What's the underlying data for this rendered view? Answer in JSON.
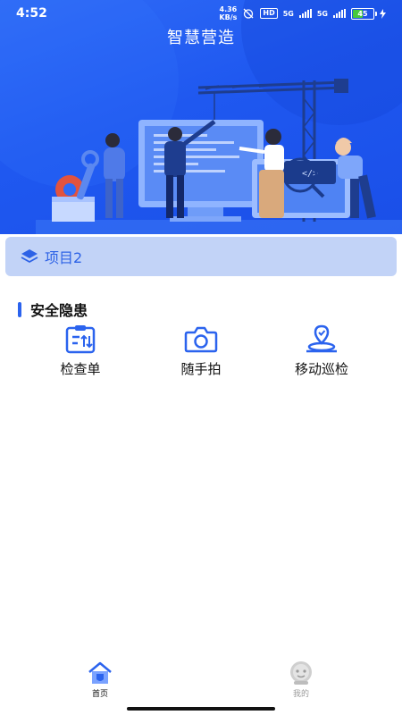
{
  "status_bar": {
    "time": "4:52",
    "net_speed_value": "4.36",
    "net_speed_unit": "KB/s",
    "hd_badge": "HD",
    "sim1_label": "5G",
    "sim2_label": "5G",
    "battery_level": "45",
    "battery_fraction": 0.45
  },
  "header": {
    "title": "智慧营造"
  },
  "project": {
    "label": "项目2"
  },
  "section": {
    "title": "安全隐患",
    "items": [
      {
        "label": "检查单",
        "icon": "checklist-icon"
      },
      {
        "label": "随手拍",
        "icon": "camera-icon"
      },
      {
        "label": "移动巡检",
        "icon": "location-route-icon"
      }
    ]
  },
  "tabbar": {
    "tabs": [
      {
        "label": "首页",
        "icon": "home-icon",
        "active": true
      },
      {
        "label": "我的",
        "icon": "profile-icon",
        "active": false
      }
    ]
  },
  "colors": {
    "primary": "#2b63ee",
    "hero_gradient_start": "#2f6bf6",
    "hero_gradient_end": "#1a4fe8",
    "project_card_bg": "#c2d3f7",
    "inactive_tab": "#9a9a9a"
  }
}
